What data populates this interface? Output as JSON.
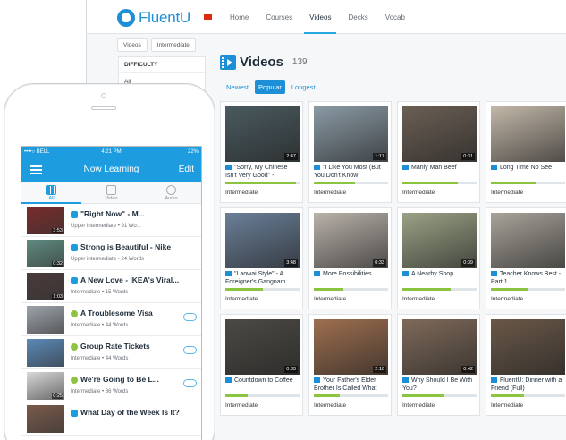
{
  "web": {
    "brand": "FluentU",
    "nav": [
      "Home",
      "Courses",
      "Videos",
      "Decks",
      "Vocab"
    ],
    "nav_active": "Videos",
    "breadcrumbs": [
      "Videos",
      "Intermediate"
    ],
    "sidebar": {
      "heading": "DIFFICULTY",
      "item": "All"
    },
    "section_title": "Videos",
    "section_count": "139",
    "sort": [
      "Newest",
      "Popular",
      "Longest"
    ],
    "sort_active": "Popular",
    "cards": [
      {
        "title": "\"Sorry, My Chinese Isn't Very Good\" -",
        "duration": "2:47",
        "level": "Intermediate",
        "progress": 0.95,
        "bg": "#4a5a5f"
      },
      {
        "title": "\"I Like You Most (But You Don't Know",
        "duration": "1:17",
        "level": "Intermediate",
        "progress": 0.55,
        "bg": "#8a9aa4"
      },
      {
        "title": "Manly Man Beef",
        "duration": "0:31",
        "level": "Intermediate",
        "progress": 0.75,
        "bg": "#6b5f55"
      },
      {
        "title": "Long Time No See",
        "duration": "",
        "level": "Intermediate",
        "progress": 0.6,
        "bg": "#c2b7a8"
      },
      {
        "title": "\"Laowai Style\" - A Foreigner's Gangnam",
        "duration": "3:48",
        "level": "Intermediate",
        "progress": 0.5,
        "bg": "#6a7f98"
      },
      {
        "title": "More Possibilities",
        "duration": "0:33",
        "level": "Intermediate",
        "progress": 0.4,
        "bg": "#b9b2aa"
      },
      {
        "title": "A Nearby Shop",
        "duration": "0:39",
        "level": "Intermediate",
        "progress": 0.65,
        "bg": "#9aa285"
      },
      {
        "title": "Teacher Knows Best - Part 1",
        "duration": "",
        "level": "Intermediate",
        "progress": 0.5,
        "bg": "#a8a39a"
      },
      {
        "title": "Countdown to Coffee",
        "duration": "0:33",
        "level": "Intermediate",
        "progress": 0.3,
        "bg": "#4d4a44"
      },
      {
        "title": "Your Father's Elder Brother Is Called What",
        "duration": "2:10",
        "level": "Intermediate",
        "progress": 0.35,
        "bg": "#9e6f4f"
      },
      {
        "title": "Why Should I Be With You?",
        "duration": "0:42",
        "level": "Intermediate",
        "progress": 0.55,
        "bg": "#7f6a5a"
      },
      {
        "title": "FluentU: Dinner with a Friend (Full)",
        "duration": "",
        "level": "Intermediate",
        "progress": 0.45,
        "bg": "#6a5848"
      }
    ]
  },
  "phone": {
    "carrier": "••••○ BELL",
    "time": "4:21 PM",
    "battery": "22%",
    "title": "Now Learning",
    "edit": "Edit",
    "tabs": [
      "All",
      "Video",
      "Audio"
    ],
    "items": [
      {
        "title": "\"Right Now\" - M...",
        "meta": "Upper intermediate • 91 Wo...",
        "duration": "3:53",
        "type": "video",
        "cloud": false,
        "bg": "#7a2b2b"
      },
      {
        "title": "Strong is Beautiful - Nike",
        "meta": "Upper intermediate • 24 Words",
        "duration": "0:32",
        "type": "video",
        "cloud": false,
        "bg": "#5f8a80"
      },
      {
        "title": "A New Love - IKEA's Viral...",
        "meta": "Intermediate • 15 Words",
        "duration": "1:03",
        "type": "video",
        "cloud": false,
        "bg": "#4a3a3a"
      },
      {
        "title": "A Troublesome Visa",
        "meta": "Intermediate • 44 Words",
        "duration": "",
        "type": "audio",
        "cloud": true,
        "bg": "#9ea4ab"
      },
      {
        "title": "Group Rate Tickets",
        "meta": "Intermediate • 44 Words",
        "duration": "",
        "type": "audio",
        "cloud": true,
        "bg": "#5b89b8"
      },
      {
        "title": "We're Going to Be L...",
        "meta": "Intermediate • 36 Words",
        "duration": "0:25",
        "type": "audio",
        "cloud": true,
        "bg": "#d8d8d8"
      },
      {
        "title": "What Day of the Week Is It?",
        "meta": "",
        "duration": "",
        "type": "video",
        "cloud": false,
        "bg": "#7a5a4a"
      }
    ]
  }
}
